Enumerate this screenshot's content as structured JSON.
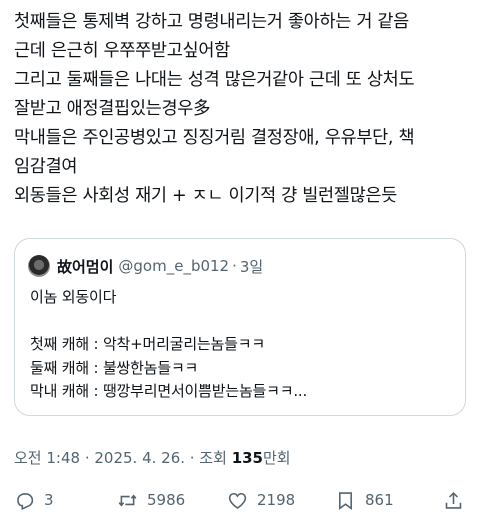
{
  "tweet": {
    "lines": [
      "첫째들은 통제벽 강하고 명령내리는거 좋아하는 거 같음",
      "근데 은근히 우쭈쭈받고싶어함",
      "그리고 둘째들은 나대는 성격 많은거같아 근데 또 상처도",
      "잘받고 애정결핍있는경우多",
      "막내들은 주인공병있고 징징거림 결정장애, 우유부단, 책",
      "임감결여",
      "외동들은 사회성 재기 + ㅈㄴ 이기적 걍 빌런젤많은듯"
    ]
  },
  "quote": {
    "name": "故어멈이",
    "handle": "@gom_e_b012",
    "separator": "·",
    "time": "3일",
    "lines": [
      "이놈 외동이다",
      "",
      "첫째 캐해 : 악착+머리굴리는놈들ㅋㅋ",
      "둘째 캐해 : 불쌍한놈들ㅋㅋ",
      "막내 캐해 : 땡깡부리면서이쁨받는놈들ㅋㅋ..."
    ]
  },
  "meta": {
    "time": "오전 1:48 · 2025. 4. 26. · 조회 ",
    "views": "135",
    "views_suffix": "만회"
  },
  "actions": {
    "replies": "3",
    "retweets": "5986",
    "likes": "2198",
    "bookmarks": "861"
  },
  "icons": {
    "reply": "reply-icon",
    "retweet": "retweet-icon",
    "like": "heart-icon",
    "bookmark": "bookmark-icon",
    "share": "share-icon"
  },
  "colors": {
    "text": "#0f1419",
    "secondary": "#536471",
    "border": "#cfd9de"
  }
}
